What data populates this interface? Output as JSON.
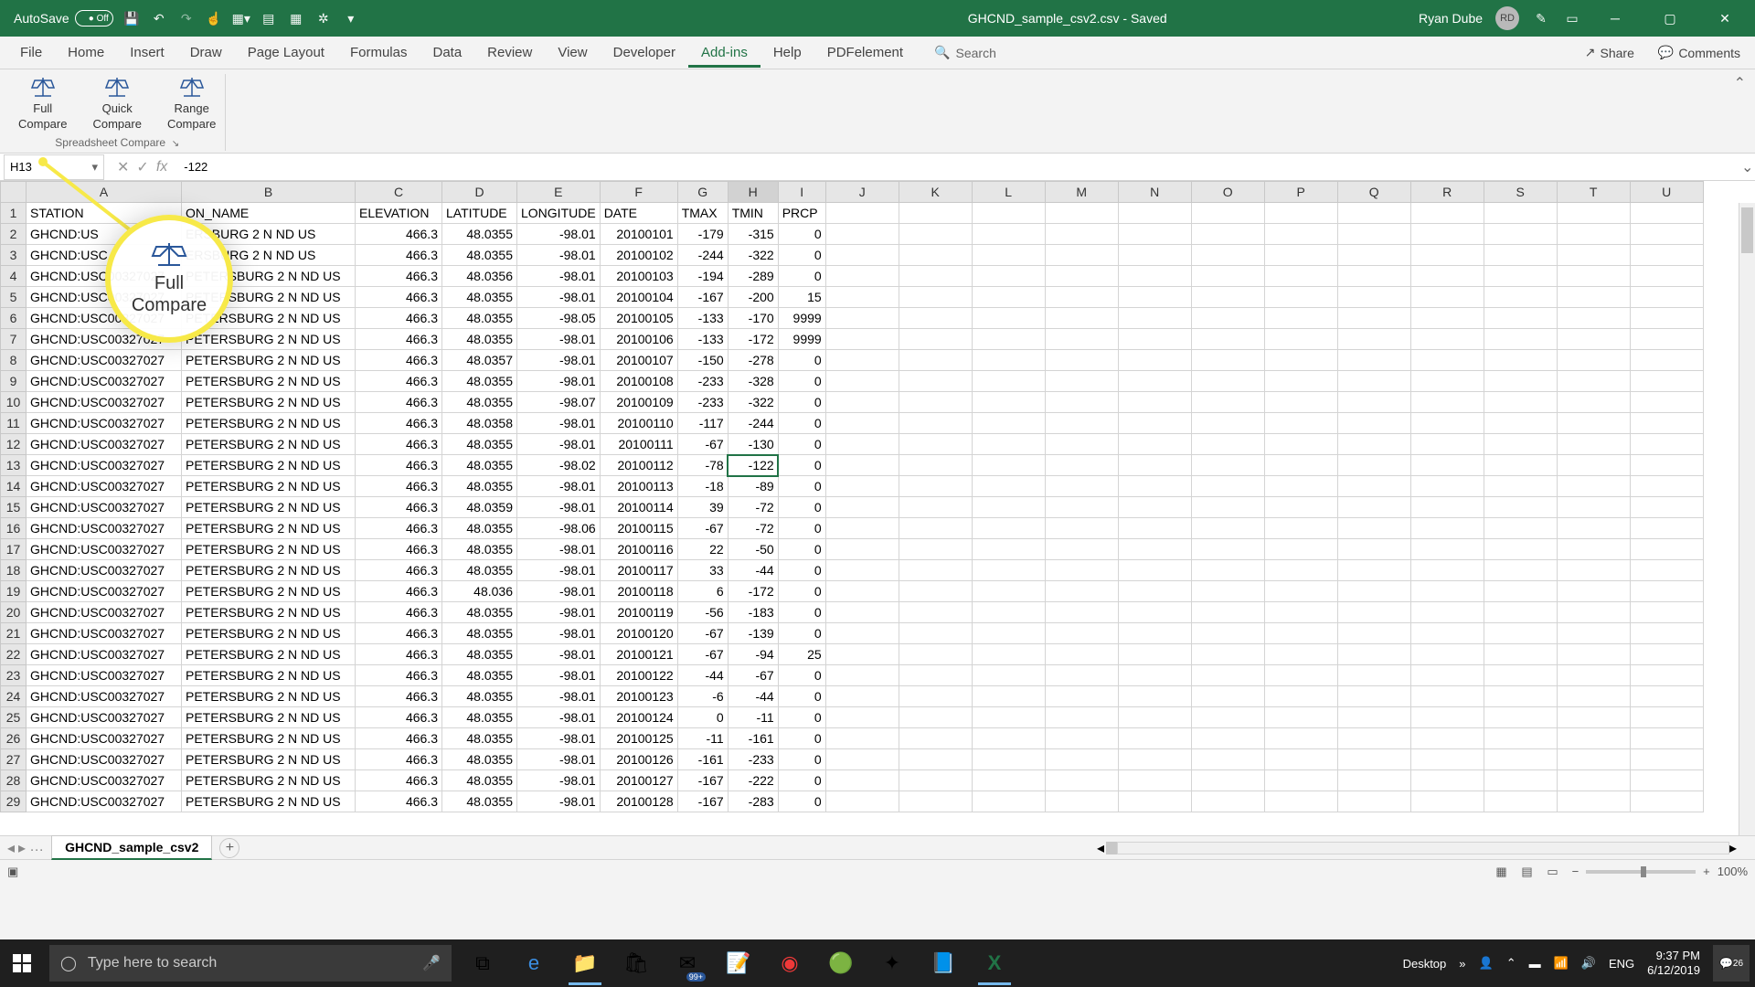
{
  "titlebar": {
    "autosave_label": "AutoSave",
    "autosave_state": "Off",
    "filename": "GHCND_sample_csv2.csv - Saved",
    "user": "Ryan Dube",
    "user_initials": "RD"
  },
  "menu": {
    "items": [
      "File",
      "Home",
      "Insert",
      "Draw",
      "Page Layout",
      "Formulas",
      "Data",
      "Review",
      "View",
      "Developer",
      "Add-ins",
      "Help",
      "PDFelement"
    ],
    "active": "Add-ins",
    "search_placeholder": "Search",
    "share": "Share",
    "comments": "Comments"
  },
  "ribbon": {
    "buttons": [
      {
        "line1": "Full",
        "line2": "Compare"
      },
      {
        "line1": "Quick",
        "line2": "Compare"
      },
      {
        "line1": "Range",
        "line2": "Compare"
      }
    ],
    "group_label": "Spreadsheet Compare"
  },
  "formula_bar": {
    "name_box": "H13",
    "formula": "-122"
  },
  "callout": {
    "line1": "Full",
    "line2": "Compare"
  },
  "grid": {
    "col_letters": [
      "A",
      "B",
      "C",
      "D",
      "E",
      "F",
      "G",
      "H",
      "I",
      "J",
      "K",
      "L",
      "M",
      "N",
      "O",
      "P",
      "Q",
      "R",
      "S",
      "T",
      "U"
    ],
    "headers": [
      "STATION",
      "ON_NAME",
      "ELEVATION",
      "LATITUDE",
      "LONGITUDE",
      "DATE",
      "TMAX",
      "TMIN",
      "PRCP"
    ],
    "active_cell": {
      "row": 13,
      "col": "H"
    },
    "rows": [
      [
        "GHCND:US",
        "ERSBURG 2 N ND US",
        "466.3",
        "48.0355",
        "-98.01",
        "20100101",
        "-179",
        "-315",
        "0"
      ],
      [
        "GHCND:USC",
        "ERSBURG 2 N ND US",
        "466.3",
        "48.0355",
        "-98.01",
        "20100102",
        "-244",
        "-322",
        "0"
      ],
      [
        "GHCND:USC00327027",
        "PETERSBURG 2 N ND US",
        "466.3",
        "48.0356",
        "-98.01",
        "20100103",
        "-194",
        "-289",
        "0"
      ],
      [
        "GHCND:USC00327027",
        "PETERSBURG 2 N ND US",
        "466.3",
        "48.0355",
        "-98.01",
        "20100104",
        "-167",
        "-200",
        "15"
      ],
      [
        "GHCND:USC00327027",
        "PETERSBURG 2 N ND US",
        "466.3",
        "48.0355",
        "-98.05",
        "20100105",
        "-133",
        "-170",
        "9999"
      ],
      [
        "GHCND:USC00327027",
        "PETERSBURG 2 N ND US",
        "466.3",
        "48.0355",
        "-98.01",
        "20100106",
        "-133",
        "-172",
        "9999"
      ],
      [
        "GHCND:USC00327027",
        "PETERSBURG 2 N ND US",
        "466.3",
        "48.0357",
        "-98.01",
        "20100107",
        "-150",
        "-278",
        "0"
      ],
      [
        "GHCND:USC00327027",
        "PETERSBURG 2 N ND US",
        "466.3",
        "48.0355",
        "-98.01",
        "20100108",
        "-233",
        "-328",
        "0"
      ],
      [
        "GHCND:USC00327027",
        "PETERSBURG 2 N ND US",
        "466.3",
        "48.0355",
        "-98.07",
        "20100109",
        "-233",
        "-322",
        "0"
      ],
      [
        "GHCND:USC00327027",
        "PETERSBURG 2 N ND US",
        "466.3",
        "48.0358",
        "-98.01",
        "20100110",
        "-117",
        "-244",
        "0"
      ],
      [
        "GHCND:USC00327027",
        "PETERSBURG 2 N ND US",
        "466.3",
        "48.0355",
        "-98.01",
        "20100111",
        "-67",
        "-130",
        "0"
      ],
      [
        "GHCND:USC00327027",
        "PETERSBURG 2 N ND US",
        "466.3",
        "48.0355",
        "-98.02",
        "20100112",
        "-78",
        "-122",
        "0"
      ],
      [
        "GHCND:USC00327027",
        "PETERSBURG 2 N ND US",
        "466.3",
        "48.0355",
        "-98.01",
        "20100113",
        "-18",
        "-89",
        "0"
      ],
      [
        "GHCND:USC00327027",
        "PETERSBURG 2 N ND US",
        "466.3",
        "48.0359",
        "-98.01",
        "20100114",
        "39",
        "-72",
        "0"
      ],
      [
        "GHCND:USC00327027",
        "PETERSBURG 2 N ND US",
        "466.3",
        "48.0355",
        "-98.06",
        "20100115",
        "-67",
        "-72",
        "0"
      ],
      [
        "GHCND:USC00327027",
        "PETERSBURG 2 N ND US",
        "466.3",
        "48.0355",
        "-98.01",
        "20100116",
        "22",
        "-50",
        "0"
      ],
      [
        "GHCND:USC00327027",
        "PETERSBURG 2 N ND US",
        "466.3",
        "48.0355",
        "-98.01",
        "20100117",
        "33",
        "-44",
        "0"
      ],
      [
        "GHCND:USC00327027",
        "PETERSBURG 2 N ND US",
        "466.3",
        "48.036",
        "-98.01",
        "20100118",
        "6",
        "-172",
        "0"
      ],
      [
        "GHCND:USC00327027",
        "PETERSBURG 2 N ND US",
        "466.3",
        "48.0355",
        "-98.01",
        "20100119",
        "-56",
        "-183",
        "0"
      ],
      [
        "GHCND:USC00327027",
        "PETERSBURG 2 N ND US",
        "466.3",
        "48.0355",
        "-98.01",
        "20100120",
        "-67",
        "-139",
        "0"
      ],
      [
        "GHCND:USC00327027",
        "PETERSBURG 2 N ND US",
        "466.3",
        "48.0355",
        "-98.01",
        "20100121",
        "-67",
        "-94",
        "25"
      ],
      [
        "GHCND:USC00327027",
        "PETERSBURG 2 N ND US",
        "466.3",
        "48.0355",
        "-98.01",
        "20100122",
        "-44",
        "-67",
        "0"
      ],
      [
        "GHCND:USC00327027",
        "PETERSBURG 2 N ND US",
        "466.3",
        "48.0355",
        "-98.01",
        "20100123",
        "-6",
        "-44",
        "0"
      ],
      [
        "GHCND:USC00327027",
        "PETERSBURG 2 N ND US",
        "466.3",
        "48.0355",
        "-98.01",
        "20100124",
        "0",
        "-11",
        "0"
      ],
      [
        "GHCND:USC00327027",
        "PETERSBURG 2 N ND US",
        "466.3",
        "48.0355",
        "-98.01",
        "20100125",
        "-11",
        "-161",
        "0"
      ],
      [
        "GHCND:USC00327027",
        "PETERSBURG 2 N ND US",
        "466.3",
        "48.0355",
        "-98.01",
        "20100126",
        "-161",
        "-233",
        "0"
      ],
      [
        "GHCND:USC00327027",
        "PETERSBURG 2 N ND US",
        "466.3",
        "48.0355",
        "-98.01",
        "20100127",
        "-167",
        "-222",
        "0"
      ],
      [
        "GHCND:USC00327027",
        "PETERSBURG 2 N ND US",
        "466.3",
        "48.0355",
        "-98.01",
        "20100128",
        "-167",
        "-283",
        "0"
      ]
    ]
  },
  "sheet_tabs": {
    "active": "GHCND_sample_csv2"
  },
  "statusbar": {
    "zoom": "100%"
  },
  "taskbar": {
    "search_placeholder": "Type here to search",
    "desktop_label": "Desktop",
    "mail_badge": "99+",
    "time": "9:37 PM",
    "date": "6/12/2019",
    "notif_count": "26"
  }
}
